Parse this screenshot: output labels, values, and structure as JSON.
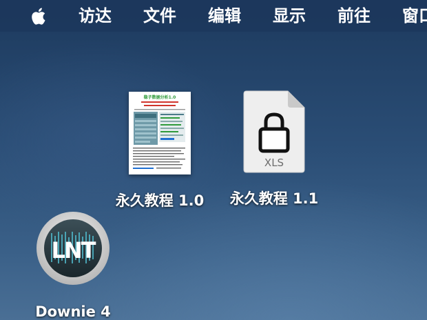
{
  "menubar": {
    "apple_icon": "apple-logo-icon",
    "items": [
      "访达",
      "文件",
      "编辑",
      "显示",
      "前往",
      "窗口"
    ]
  },
  "desktop": {
    "files": [
      {
        "label": "永久教程 1.0",
        "icon": "document-preview-icon",
        "preview_heading": "稳子数据分析1.0"
      },
      {
        "label": "永久教程 1.1",
        "icon": "locked-xls-file-icon",
        "badge": "XLS"
      }
    ],
    "apps": [
      {
        "label": "Downie 4",
        "icon": "downie-app-icon",
        "logo_text": "LNT"
      }
    ]
  },
  "colors": {
    "menubar": "#1c375c",
    "desktop_top": "#1d3a5e",
    "desktop_bottom": "#4a6f95",
    "preview_heading": "#2e9a3a",
    "preview_red": "#d0342c"
  }
}
